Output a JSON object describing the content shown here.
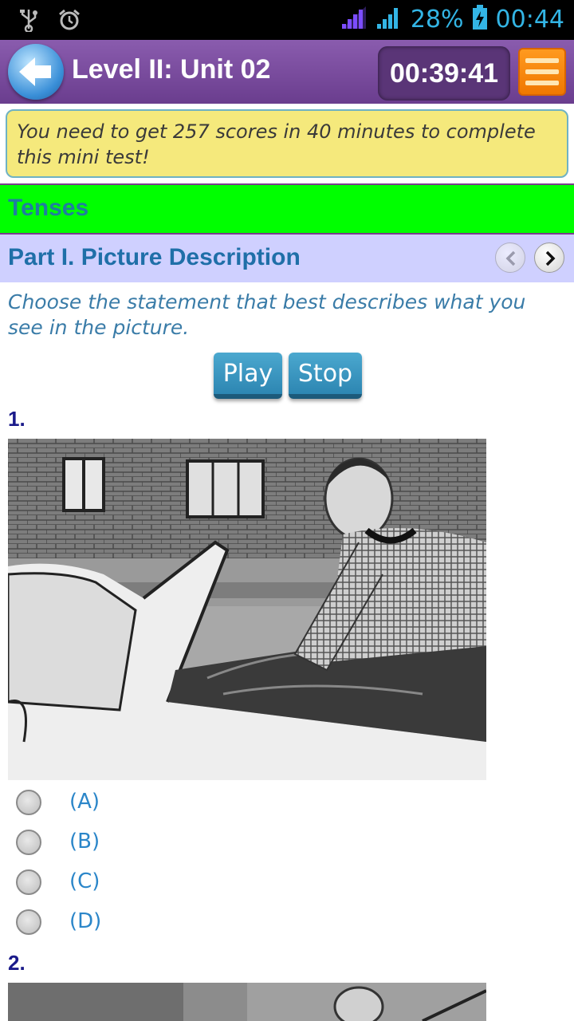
{
  "status_bar": {
    "battery": "28%",
    "time": "00:44",
    "icons": [
      "usb-icon",
      "alarm-icon",
      "signal-icon",
      "signal-icon",
      "battery-charging-icon"
    ]
  },
  "header": {
    "title": "Level II: Unit 02",
    "timer": "00:39:41",
    "back_icon": "back-arrow-icon",
    "menu_icon": "hamburger-menu-icon"
  },
  "notice": "You need to get 257 scores in 40 minutes to complete this mini test!",
  "section": "Tenses",
  "part": {
    "title": "Part I. Picture Description",
    "instruction": "Choose the statement that best describes what you see in the picture."
  },
  "audio": {
    "play_label": "Play",
    "stop_label": "Stop"
  },
  "questions": [
    {
      "number": "1.",
      "options": [
        "(A)",
        "(B)",
        "(C)",
        "(D)"
      ]
    },
    {
      "number": "2."
    }
  ],
  "colors": {
    "header_purple": "#6a3d8e",
    "section_green": "#00ff00",
    "part_lavender": "#cfd0ff",
    "notice_yellow": "#f5e97c",
    "accent_blue": "#2b86c9",
    "menu_orange": "#f07800"
  }
}
